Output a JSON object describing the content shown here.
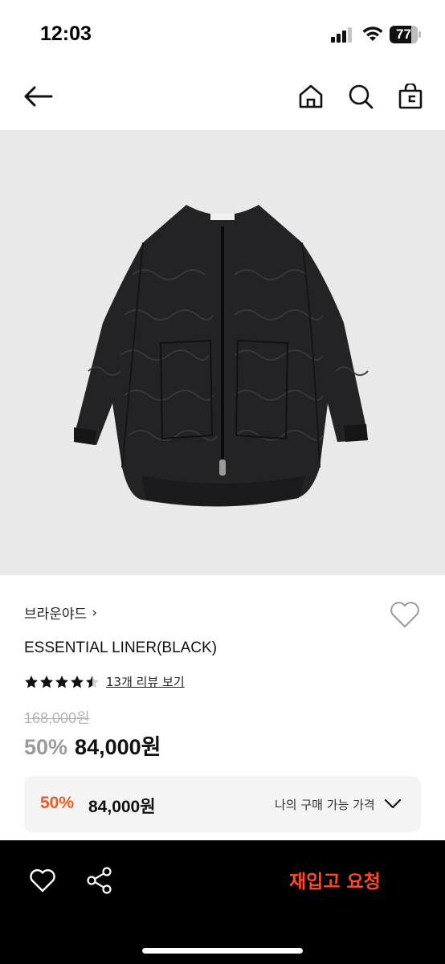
{
  "status_bar": {
    "time": "12:03",
    "battery_level": "77",
    "battery_fraction": 0.77
  },
  "nav": {
    "icons": [
      "arrow-left-icon",
      "home-icon",
      "search-icon",
      "shopping-bag-icon"
    ]
  },
  "product": {
    "image_description_icon": "quilted-jacket-image",
    "brand": "브라운야드",
    "brand_chevron": "›",
    "name": "ESSENTIAL LINER(BLACK)",
    "rating_fraction": 0.9,
    "review_link": "13개 리뷰 보기",
    "original_price": "168,000원",
    "discount_rate": "50%",
    "sale_price": "84,000원"
  },
  "my_price": {
    "discount_rate": "50%",
    "price": "84,000원",
    "label": "나의 구매 가능 가격"
  },
  "bottom_bar": {
    "restock_label": "재입고 요청"
  },
  "colors": {
    "accent": "#f25a1e",
    "restock": "#ff4a21",
    "image_bg": "#e9e9e9",
    "price_box_bg": "#f4f4f4"
  }
}
